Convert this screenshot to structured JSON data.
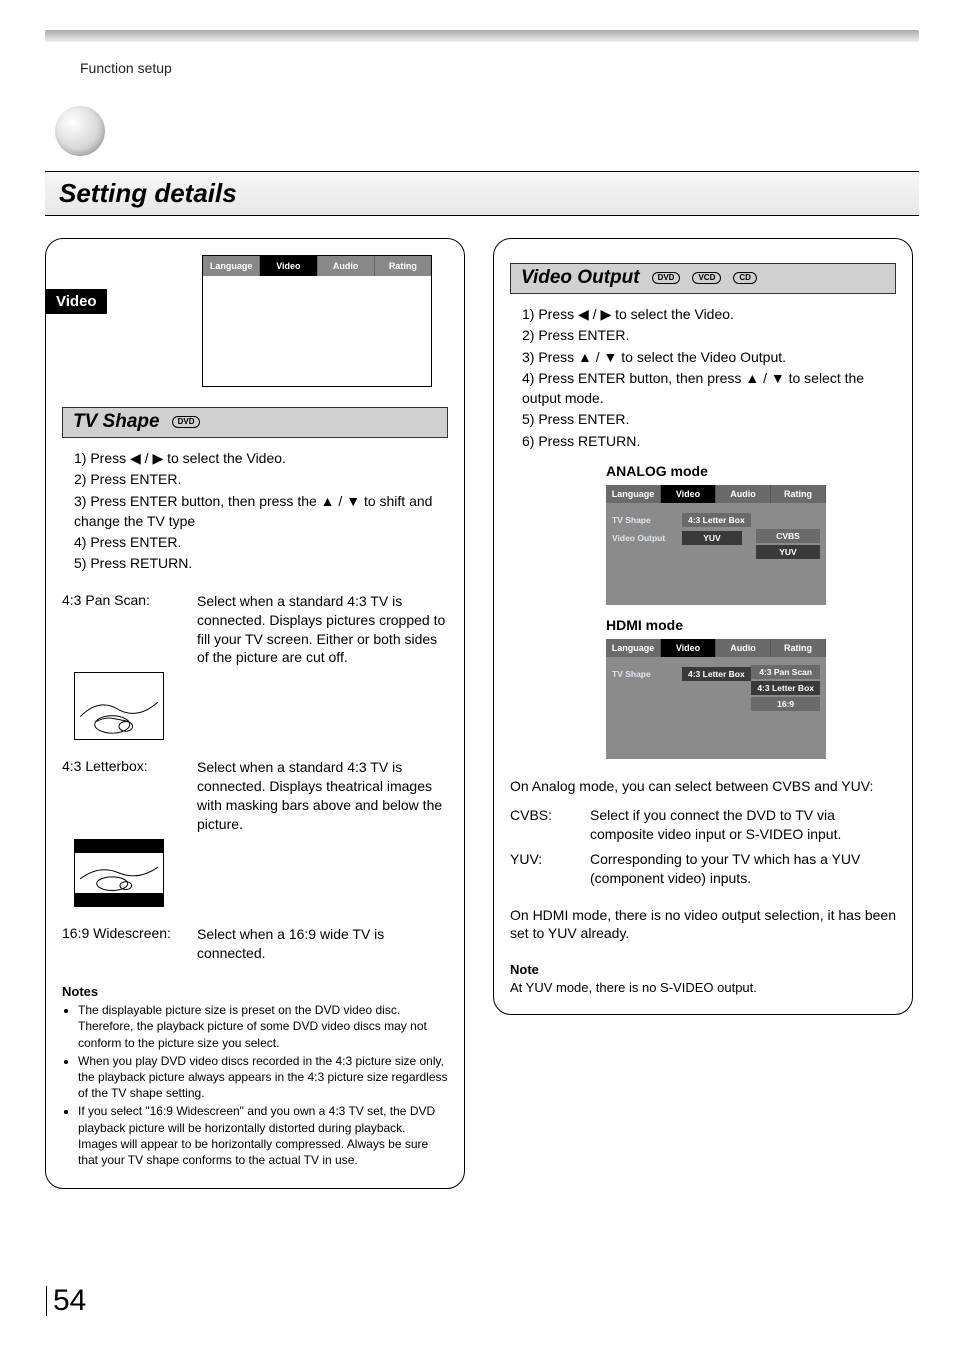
{
  "breadcrumb": "Function setup",
  "title": "Setting details",
  "page_number": "54",
  "video_label": "Video",
  "osd_tabs": [
    "Language",
    "Video",
    "Audio",
    "Rating"
  ],
  "tv_shape": {
    "heading": "TV Shape",
    "tags": [
      "DVD"
    ],
    "steps": [
      "1)  Press ◀ / ▶  to select the Video.",
      "2)  Press ENTER.",
      "3)  Press ENTER button, then press the ▲ / ▼ to shift and change the TV type",
      "4)  Press ENTER.",
      "5)  Press RETURN."
    ],
    "options": [
      {
        "label": "4:3 Pan Scan:",
        "desc": "Select when a standard 4:3 TV is connected.\nDisplays pictures cropped to fill your TV screen.  Either or both sides of the picture are cut off."
      },
      {
        "label": "4:3 Letterbox:",
        "desc": "Select when a standard 4:3 TV is connected.\nDisplays theatrical images with masking bars above and below the picture."
      },
      {
        "label": "16:9 Widescreen:",
        "desc": "Select when a 16:9 wide TV is connected."
      }
    ],
    "notes_heading": "Notes",
    "notes": [
      "The displayable picture size is preset on the DVD video disc. Therefore, the playback picture of some DVD video discs may not conform to the picture size you select.",
      "When you play DVD video discs recorded in the 4:3 picture size only, the playback picture always appears in the 4:3 picture size regardless of the TV shape setting.",
      "If you select \"16:9 Widescreen\" and you own a 4:3 TV set, the DVD playback picture will be horizontally distorted during playback. Images will appear to be horizontally compressed.  Always be sure that your TV shape conforms to the actual TV in use."
    ]
  },
  "video_output": {
    "heading": "Video Output",
    "tags": [
      "DVD",
      "VCD",
      "CD"
    ],
    "steps": [
      "1)  Press ◀ / ▶  to select the Video.",
      "2)  Press ENTER.",
      "3)  Press  ▲ / ▼ to select the Video Output.",
      "4)  Press ENTER button, then press ▲ / ▼ to select the output mode.",
      "5)  Press ENTER.",
      "6)  Press RETURN."
    ],
    "analog_label": "ANALOG mode",
    "analog_menu": {
      "tabs": [
        "Language",
        "Video",
        "Audio",
        "Rating"
      ],
      "rows": [
        {
          "label": "TV Shape",
          "value": "4:3 Letter Box"
        },
        {
          "label": "Video Output",
          "value": "YUV"
        }
      ],
      "dropdown": [
        "CVBS",
        "YUV"
      ]
    },
    "hdmi_label": "HDMI mode",
    "hdmi_menu": {
      "tabs": [
        "Language",
        "Video",
        "Audio",
        "Rating"
      ],
      "rows": [
        {
          "label": "TV Shape",
          "value": "4:3 Letter Box"
        }
      ],
      "dropdown": [
        "4:3 Pan Scan",
        "4:3 Letter Box",
        "16:9"
      ]
    },
    "body1": "On Analog mode, you can select between CVBS and YUV:",
    "defs": [
      {
        "k": "CVBS:",
        "v": "Select if you connect the DVD to TV via composite video input or S-VIDEO input."
      },
      {
        "k": "YUV:",
        "v": "Corresponding to your TV which has a YUV (component video) inputs."
      }
    ],
    "body2": "On HDMI mode, there is no video output selection, it has been set to YUV already.",
    "note_heading": "Note",
    "note_body": "At YUV mode, there is no S-VIDEO output."
  }
}
